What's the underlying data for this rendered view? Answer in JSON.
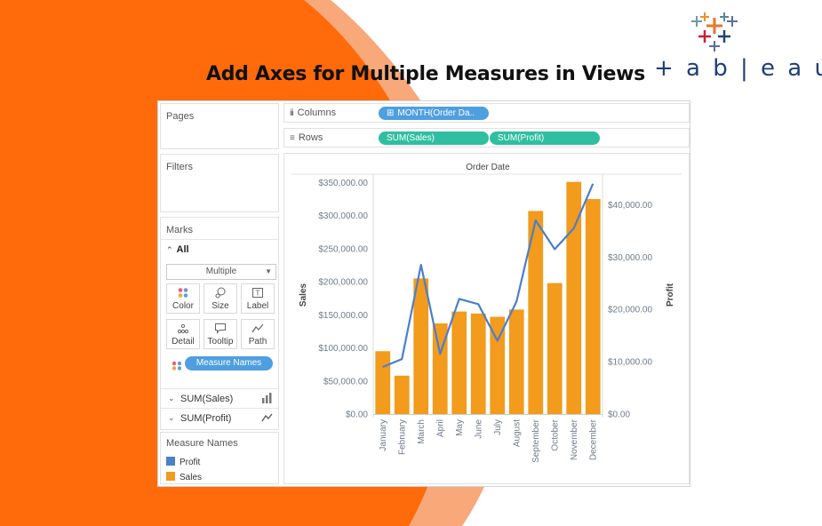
{
  "headline": "Add Axes for Multiple Measures in Views",
  "brand": {
    "name": "tableau",
    "colors": [
      "#e8762d",
      "#5b6f9c",
      "#c72037",
      "#1f457e",
      "#59879b",
      "#eb912b"
    ]
  },
  "panels": {
    "pages": "Pages",
    "filters": "Filters",
    "marks": {
      "title": "Marks",
      "all_label": "All",
      "mark_type": "Multiple",
      "buttons": [
        {
          "label": "Color",
          "icon": "color-dots-icon"
        },
        {
          "label": "Size",
          "icon": "size-icon"
        },
        {
          "label": "Label",
          "icon": "label-icon"
        },
        {
          "label": "Detail",
          "icon": "detail-icon"
        },
        {
          "label": "Tooltip",
          "icon": "tooltip-icon"
        },
        {
          "label": "Path",
          "icon": "path-icon"
        }
      ],
      "color_pill": "Measure Names",
      "measures": [
        {
          "name": "SUM(Sales)",
          "mark_icon": "bar-mark-icon"
        },
        {
          "name": "SUM(Profit)",
          "mark_icon": "line-mark-icon"
        }
      ]
    },
    "legend": {
      "title": "Measure Names",
      "items": [
        {
          "label": "Profit",
          "color": "#4a7fcc"
        },
        {
          "label": "Sales",
          "color": "#f29b1c"
        }
      ]
    }
  },
  "shelves": {
    "columns": {
      "label": "Columns",
      "pills": [
        "MONTH(Order Da.."
      ]
    },
    "rows": {
      "label": "Rows",
      "pills": [
        "SUM(Sales)",
        "SUM(Profit)"
      ]
    }
  },
  "chart_data": {
    "type": "bar",
    "title": "Order Date",
    "categories": [
      "January",
      "February",
      "March",
      "April",
      "May",
      "June",
      "July",
      "August",
      "September",
      "October",
      "November",
      "December"
    ],
    "series": [
      {
        "name": "Sales",
        "type": "bar",
        "axis": "left",
        "color": "#f29b1c",
        "values": [
          95000,
          58000,
          205000,
          137000,
          155000,
          152000,
          147000,
          158000,
          307000,
          198000,
          351000,
          325000
        ]
      },
      {
        "name": "Profit",
        "type": "line",
        "axis": "right",
        "color": "#4a7fcc",
        "values": [
          9000,
          10500,
          28500,
          11500,
          22000,
          21000,
          14000,
          21500,
          37000,
          31500,
          35500,
          44000
        ]
      }
    ],
    "ylabel": "Sales",
    "y2label": "Profit",
    "ylim": [
      0,
      360000
    ],
    "y2lim": [
      0,
      45500
    ],
    "yticks": [
      "$0.00",
      "$50,000.00",
      "$100,000.00",
      "$150,000.00",
      "$200,000.00",
      "$250,000.00",
      "$300,000.00",
      "$350,000.00"
    ],
    "ytick_values": [
      0,
      50000,
      100000,
      150000,
      200000,
      250000,
      300000,
      350000
    ],
    "y2ticks": [
      "$0.00",
      "$10,000.00",
      "$20,000.00",
      "$30,000.00",
      "$40,000.00"
    ],
    "y2tick_values": [
      0,
      10000,
      20000,
      30000,
      40000
    ],
    "grid": false
  }
}
